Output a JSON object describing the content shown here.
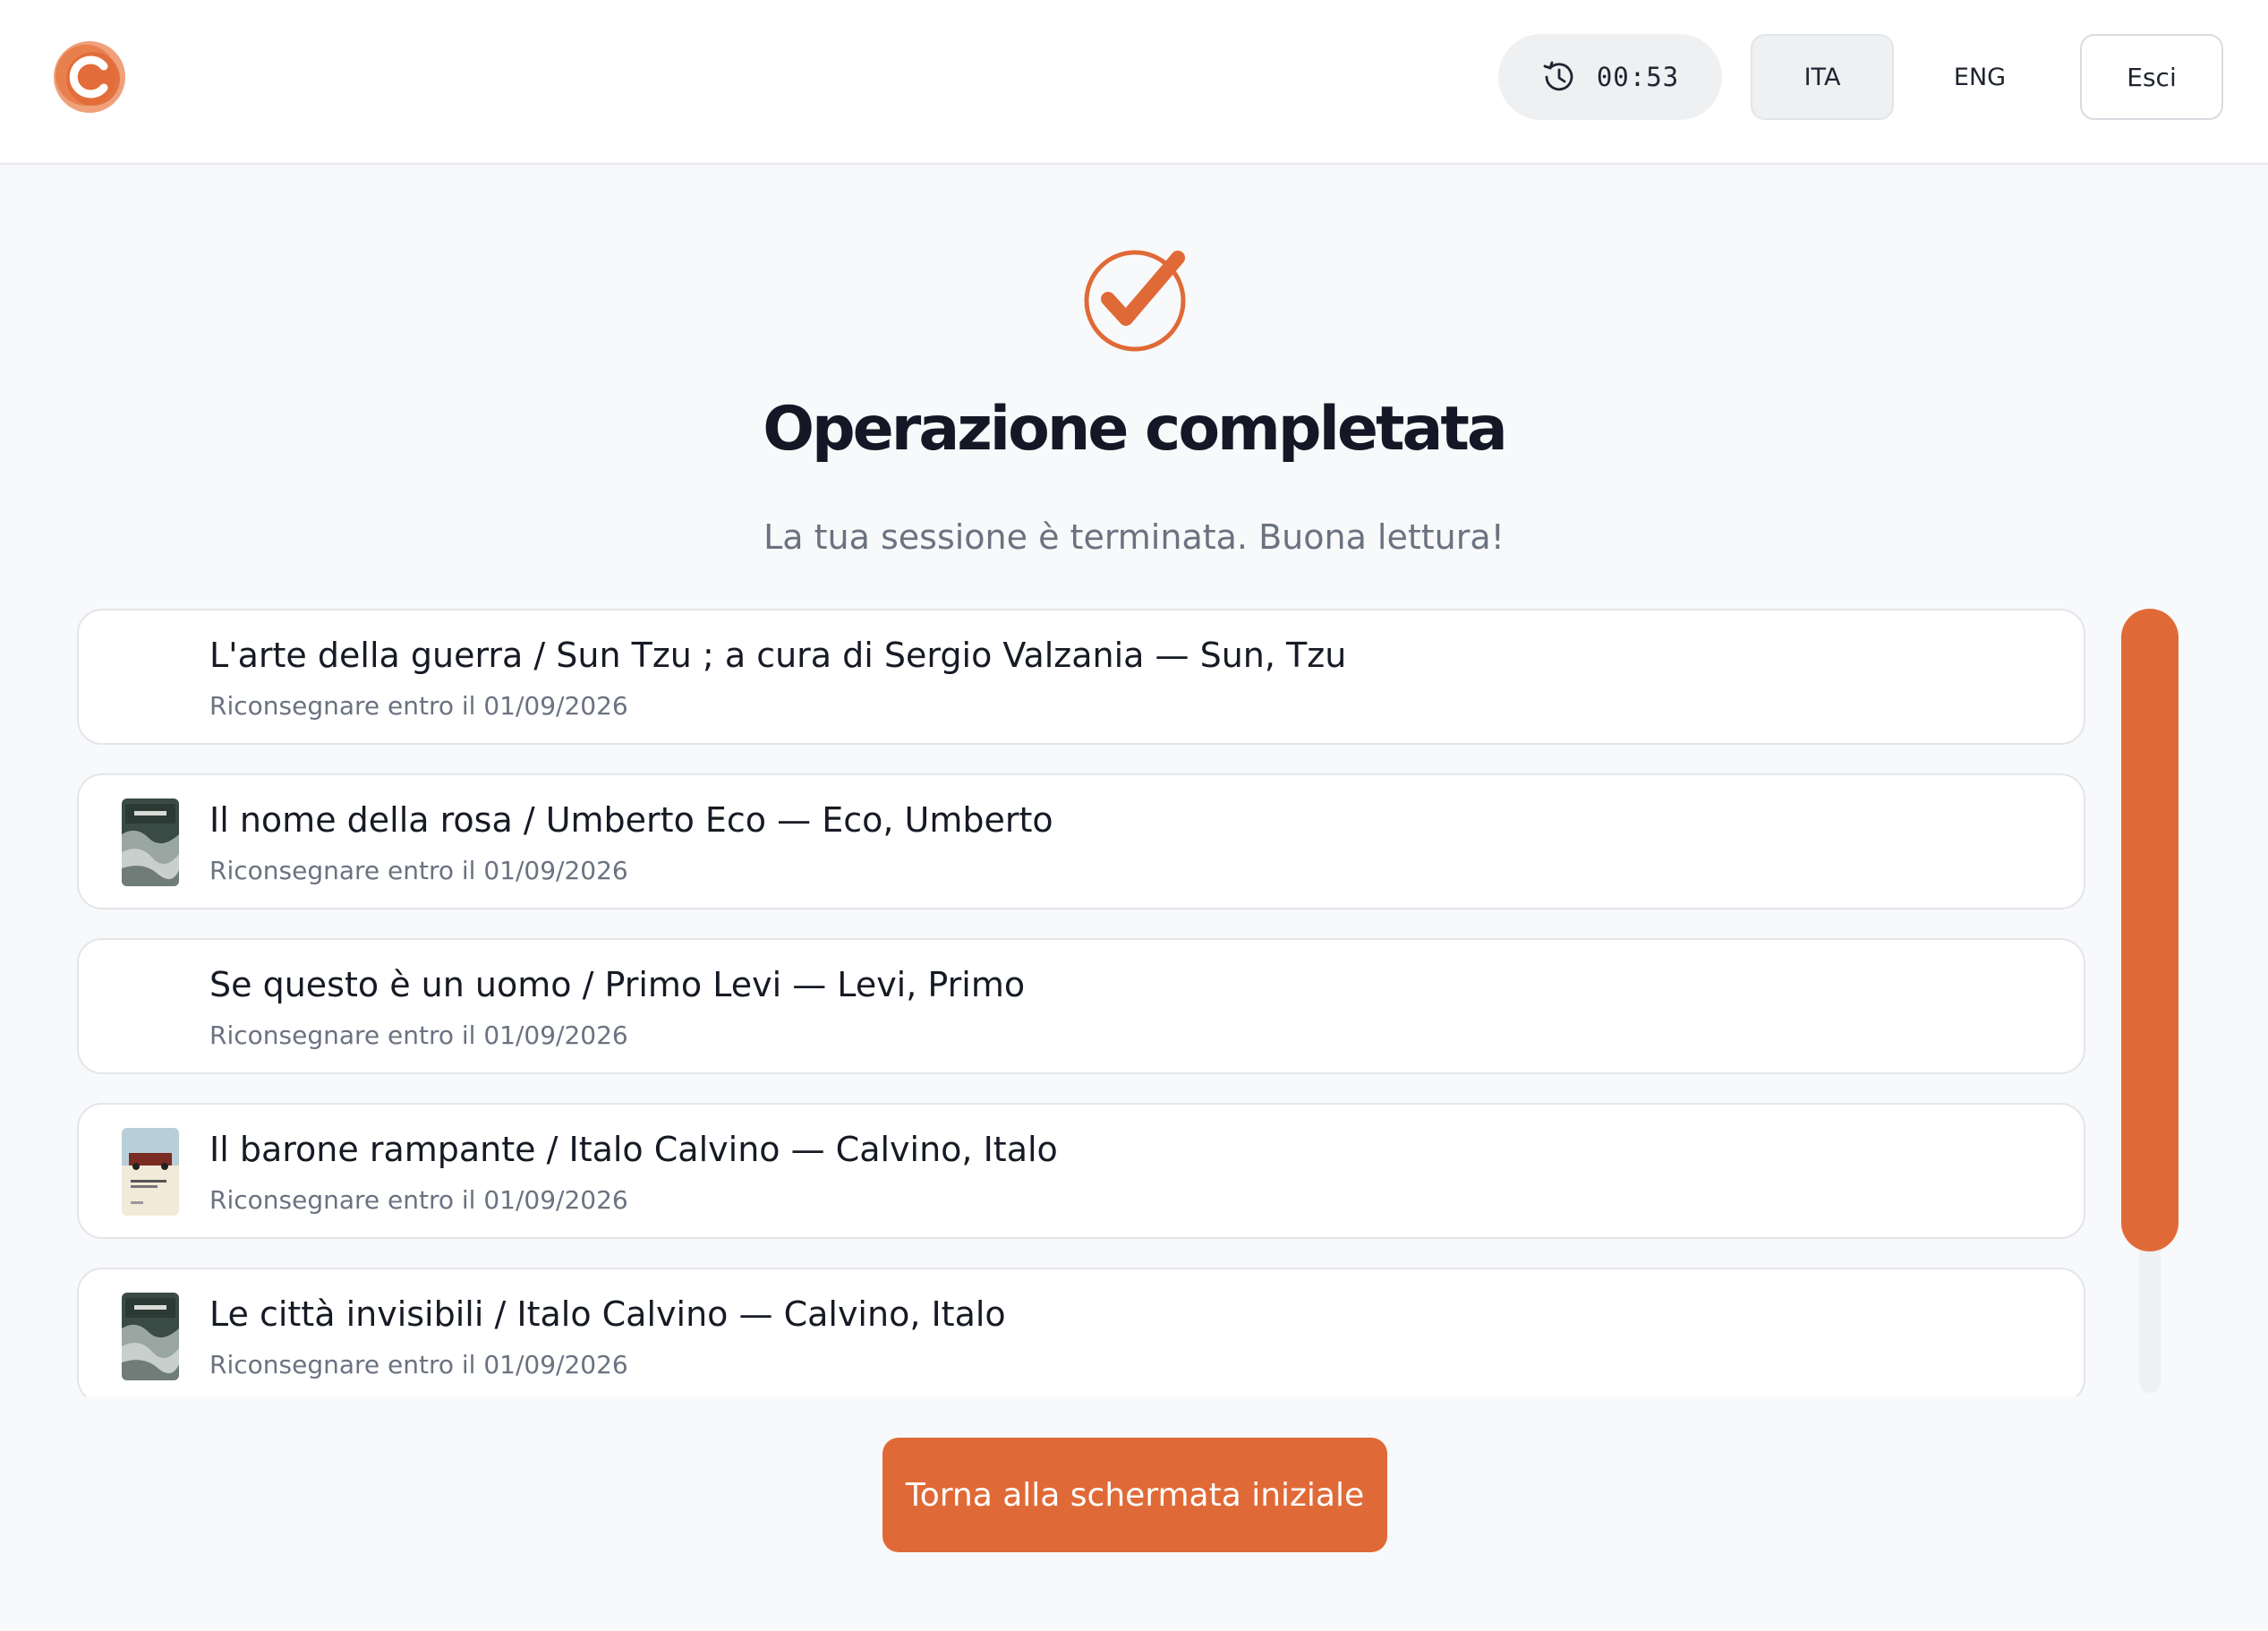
{
  "header": {
    "logo_icon": "c-logo-icon",
    "timer": {
      "icon": "clock-history-icon",
      "value": "00:53"
    },
    "languages": [
      {
        "label": "ITA",
        "selected": true
      },
      {
        "label": "ENG",
        "selected": false
      }
    ],
    "exit_label": "Esci"
  },
  "main": {
    "status_icon": "check-circle-icon",
    "title": "Operazione completata",
    "subtitle": "La tua sessione è terminata. Buona lettura!",
    "loans": [
      {
        "title": "L'arte della guerra / Sun Tzu ; a cura di Sergio Valzania — Sun, Tzu",
        "due": "Riconsegnare entro il 01/09/2026",
        "has_cover": false
      },
      {
        "title": "Il nome della rosa / Umberto Eco — Eco, Umberto",
        "due": "Riconsegnare entro il 01/09/2026",
        "has_cover": true
      },
      {
        "title": "Se questo è un uomo / Primo Levi — Levi, Primo",
        "due": "Riconsegnare entro il 01/09/2026",
        "has_cover": false
      },
      {
        "title": "Il barone rampante / Italo Calvino — Calvino, Italo",
        "due": "Riconsegnare entro il 01/09/2026",
        "has_cover": true
      },
      {
        "title": "Le città invisibili / Italo Calvino — Calvino, Italo",
        "due": "Riconsegnare entro il 01/09/2026",
        "has_cover": true
      }
    ],
    "home_button_label": "Torna alla schermata iniziale"
  },
  "colors": {
    "accent": "#e06a37",
    "background": "#f8f9fa",
    "text": "#161a24",
    "muted": "#6b7280"
  }
}
